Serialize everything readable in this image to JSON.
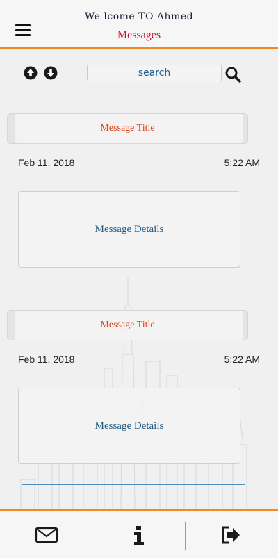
{
  "header": {
    "welcome": "We lcome TO Ahmed",
    "title": "Messages"
  },
  "toolbar": {
    "search_placeholder": "search",
    "sort_up_icon": "arrow-circle-up-icon",
    "sort_down_icon": "arrow-circle-down-icon",
    "search_icon": "magnifier-icon"
  },
  "messages": [
    {
      "title": "Message Title",
      "date": "Feb 11, 2018",
      "time": "5:22 AM",
      "details": "Message Details"
    },
    {
      "title": "Message Title",
      "date": "Feb 11, 2018",
      "time": "5:22 AM",
      "details": "Message Details"
    }
  ],
  "footer": {
    "buttons": [
      "envelope-icon",
      "info-icon",
      "sign-out-icon"
    ]
  },
  "colors": {
    "accent": "#f08a1c",
    "title_red": "#c8102e",
    "message_title": "#e2411a",
    "details_blue": "#205a80",
    "divider_blue": "#4a90c0"
  }
}
